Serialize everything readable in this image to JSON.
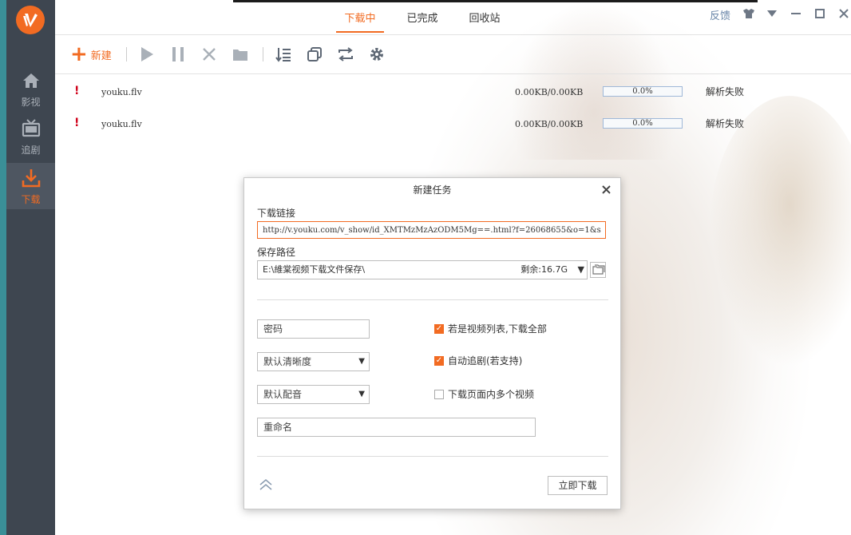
{
  "sidebar": {
    "items": [
      {
        "label": "影视",
        "icon": "home-icon"
      },
      {
        "label": "追剧",
        "icon": "tv-icon"
      },
      {
        "label": "下载",
        "icon": "download-icon"
      }
    ],
    "active_color": "#f26b22"
  },
  "header": {
    "tabs": [
      "下载中",
      "已完成",
      "回收站"
    ],
    "feedback": "反馈",
    "controls": [
      "shirt-icon",
      "dropdown-icon",
      "minimize-icon",
      "maximize-icon",
      "close-icon"
    ]
  },
  "toolbar": {
    "new_label": "新建",
    "icons": [
      "play-icon",
      "pause-icon",
      "delete-icon",
      "folder-icon",
      "sort-icon",
      "copy-icon",
      "refresh-icon",
      "settings-icon"
    ]
  },
  "downloads": [
    {
      "name": "youku.flv",
      "size": "0.00KB/0.00KB",
      "progress": "0.0%",
      "status": "解析失败"
    },
    {
      "name": "youku.flv",
      "size": "0.00KB/0.00KB",
      "progress": "0.0%",
      "status": "解析失败"
    }
  ],
  "dialog": {
    "title": "新建任务",
    "url_label": "下载链接",
    "url_value": "http://v.youku.com/v_show/id_XMTMzMzAzODM5Mg==.html?f=26068655&o=1&s",
    "path_label": "保存路径",
    "path_value": "E:\\維棠视频下载文件保存\\",
    "remaining": "剩余:16.7G",
    "password_placeholder": "密码",
    "quality": "默认清晰度",
    "audio": "默认配音",
    "rename_placeholder": "重命名",
    "opt_list": "若是视频列表,下载全部",
    "opt_follow": "自动追剧(若支持)",
    "opt_multi": "下载页面内多个视频",
    "download_now": "立即下载"
  }
}
